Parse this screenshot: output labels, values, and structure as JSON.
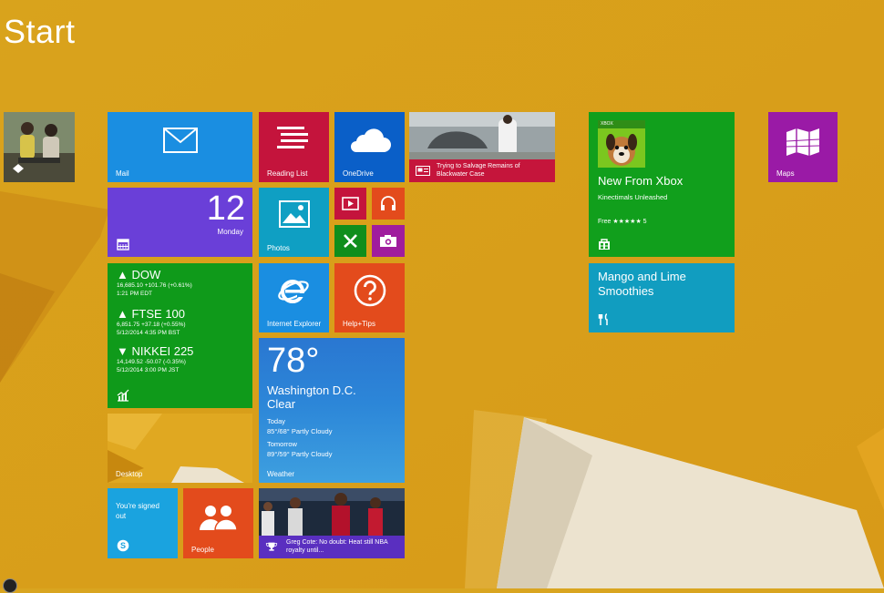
{
  "start": {
    "title": "Start"
  },
  "tiles": {
    "mail": {
      "label": "Mail",
      "color": "#1a8ee1"
    },
    "reading_list": {
      "label": "Reading List",
      "color": "#c4143c"
    },
    "onedrive": {
      "label": "OneDrive",
      "color": "#0a5fc8"
    },
    "news": {
      "caption": "Trying to Salvage Remains of Blackwater Case",
      "color": "#c5153b"
    },
    "calendar": {
      "day_number": "12",
      "day_name": "Monday",
      "color": "#6a3fd8"
    },
    "photos": {
      "label": "Photos",
      "color": "#0f9fc3"
    },
    "video": {
      "color": "#c4143c"
    },
    "music": {
      "color": "#e34b1c"
    },
    "games": {
      "color": "#108e1c"
    },
    "camera": {
      "color": "#a01c9e"
    },
    "finance": {
      "color": "#0f9a1a",
      "stocks": [
        {
          "name": "▲ DOW",
          "line1": "16,685.10 +101.76 (+0.61%)",
          "line2": "1:21 PM EDT"
        },
        {
          "name": "▲ FTSE 100",
          "line1": "6,851.75 +37.18 (+0.55%)",
          "line2": "5/12/2014 4:35 PM BST"
        },
        {
          "name": "▼ NIKKEI 225",
          "line1": "14,149.52 -50.07 (-0.35%)",
          "line2": "5/12/2014 3:00 PM JST"
        }
      ]
    },
    "ie": {
      "label": "Internet Explorer",
      "color": "#1a8ee1"
    },
    "help": {
      "label": "Help+Tips",
      "color": "#e34b1c"
    },
    "weather": {
      "label": "Weather",
      "temp": "78°",
      "city": "Washington D.C.",
      "condition": "Clear",
      "today_label": "Today",
      "today_value": "85°/68° Partly Cloudy",
      "tomorrow_label": "Tomorrow",
      "tomorrow_value": "89°/59° Partly Cloudy",
      "color": "#1a6fcc"
    },
    "desktop": {
      "label": "Desktop"
    },
    "skype": {
      "text": "You're signed out",
      "color": "#1aa3df"
    },
    "people": {
      "label": "People",
      "color": "#e34b1c"
    },
    "sports": {
      "caption": "Greg Cote: No doubt: Heat still NBA royalty until...",
      "color": "#5a2fc0"
    },
    "xbox": {
      "badge": "XBOX",
      "title": "New From Xbox",
      "subtitle": "Kinectimals Unleashed",
      "rating": "Free ★★★★★ 5",
      "color": "#119f1c"
    },
    "recipe": {
      "title": "Mango and Lime Smoothies",
      "color": "#119dc0"
    },
    "maps": {
      "label": "Maps",
      "color": "#9a1aa6"
    }
  }
}
